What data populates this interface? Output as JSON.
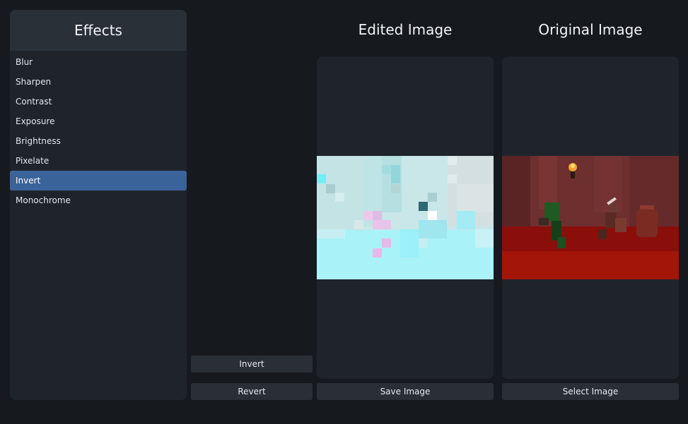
{
  "sidebar": {
    "title": "Effects",
    "items": [
      {
        "label": "Blur"
      },
      {
        "label": "Sharpen"
      },
      {
        "label": "Contrast"
      },
      {
        "label": "Exposure"
      },
      {
        "label": "Brightness"
      },
      {
        "label": "Pixelate"
      },
      {
        "label": "Invert",
        "selected": true
      },
      {
        "label": "Monochrome"
      }
    ]
  },
  "controls": {
    "apply_label": "Invert",
    "revert_label": "Revert"
  },
  "edited": {
    "title": "Edited Image",
    "save_label": "Save Image"
  },
  "original": {
    "title": "Original Image",
    "select_label": "Select Image"
  },
  "colors": {
    "accent": "#3a6399",
    "background": "#161a1f",
    "panel": "#1f242b"
  }
}
